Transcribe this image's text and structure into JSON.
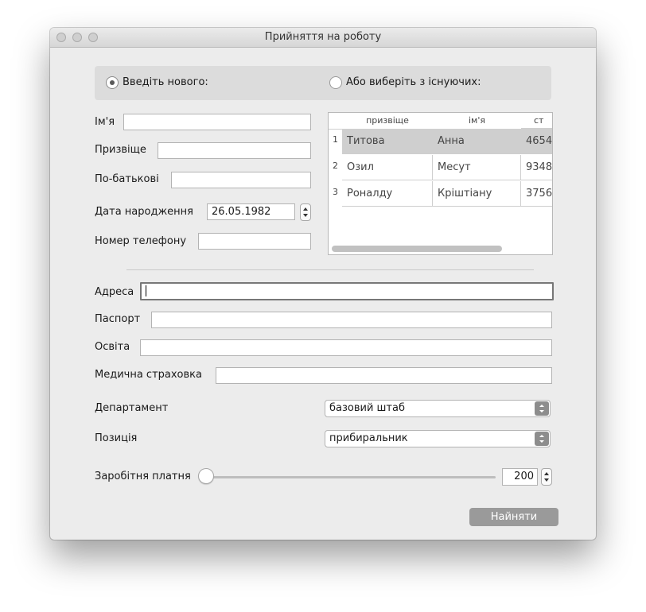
{
  "window": {
    "title": "Прийняття на роботу"
  },
  "mode": {
    "new_label": "Введіть нового:",
    "existing_label": "Або виберіть з існуючих:",
    "selected": "new"
  },
  "form": {
    "first_name_label": "Ім'я",
    "first_name_value": "",
    "last_name_label": "Призвіще",
    "last_name_value": "",
    "patronymic_label": "По-батькові",
    "patronymic_value": "",
    "birth_label": "Дата народження",
    "birth_value": "26.05.1982",
    "phone_label": "Номер телефону",
    "phone_value": "",
    "address_label": "Адреса",
    "address_value": "",
    "passport_label": "Паспорт",
    "passport_value": "",
    "education_label": "Освіта",
    "education_value": "",
    "insurance_label": "Медична страховка",
    "insurance_value": "",
    "department_label": "Департамент",
    "department_value": "базовий штаб",
    "position_label": "Позиція",
    "position_value": "прибиральник",
    "salary_label": "Заробітня платня",
    "salary_value": "200"
  },
  "table": {
    "columns": [
      "призвіще",
      "ім'я",
      "ст"
    ],
    "rows": [
      {
        "num": "1",
        "last": "Титова",
        "first": "Анна",
        "third": "4654"
      },
      {
        "num": "2",
        "last": "Озил",
        "first": "Месут",
        "third": "9348"
      },
      {
        "num": "3",
        "last": "Роналду",
        "first": "Кріштіану",
        "third": "3756"
      }
    ]
  },
  "actions": {
    "hire_label": "Найняти"
  }
}
